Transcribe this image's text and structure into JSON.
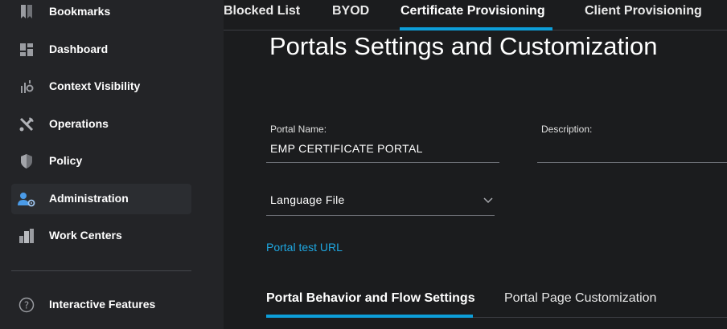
{
  "sidebar": {
    "items": [
      {
        "label": "Bookmarks",
        "icon": "bookmark-icon"
      },
      {
        "label": "Dashboard",
        "icon": "dashboard-icon"
      },
      {
        "label": "Context Visibility",
        "icon": "context-visibility-icon"
      },
      {
        "label": "Operations",
        "icon": "tools-icon"
      },
      {
        "label": "Policy",
        "icon": "shield-icon"
      },
      {
        "label": "Administration",
        "icon": "admin-user-gear-icon",
        "active": true
      },
      {
        "label": "Work Centers",
        "icon": "buildings-icon"
      }
    ],
    "footer_item": {
      "label": "Interactive Features",
      "icon": "question-circle-icon"
    }
  },
  "tabs": [
    {
      "label": "Blocked List"
    },
    {
      "label": "BYOD"
    },
    {
      "label": "Certificate Provisioning",
      "active": true
    },
    {
      "label": "Client Provisioning"
    }
  ],
  "page": {
    "title": "Portals Settings and Customization"
  },
  "form": {
    "portal_name_label": "Portal Name:",
    "portal_name_value": "EMP CERTIFICATE PORTAL",
    "description_label": "Description:",
    "description_value": "",
    "language_file_label": "Language File",
    "portal_test_url": "Portal test URL"
  },
  "subtabs": [
    {
      "label": "Portal Behavior and Flow Settings",
      "active": true
    },
    {
      "label": "Portal Page Customization"
    }
  ],
  "colors": {
    "accent": "#0d9ed9",
    "link": "#1ea7e1",
    "sidebar_bg": "#232427",
    "main_bg": "#1b1c1e"
  }
}
